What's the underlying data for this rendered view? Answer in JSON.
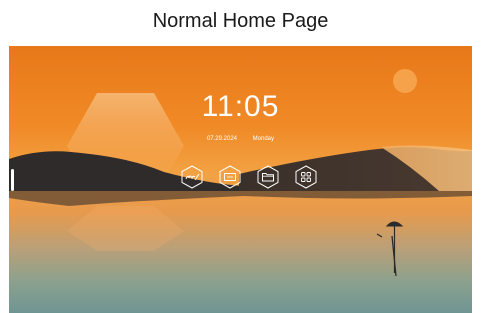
{
  "caption": "Normal Home Page",
  "clock": {
    "time": "11:05",
    "date": "07.29.2024",
    "weekday": "Monday"
  },
  "dock": [
    {
      "name": "whiteboard-app-icon"
    },
    {
      "name": "screen-share-app-icon"
    },
    {
      "name": "file-manager-app-icon"
    },
    {
      "name": "all-apps-icon"
    }
  ],
  "colors": {
    "sky_top": "#e8781a",
    "sun": "#f6a24a",
    "dune": "#2f2b2a",
    "water_bottom": "#6f9593"
  }
}
